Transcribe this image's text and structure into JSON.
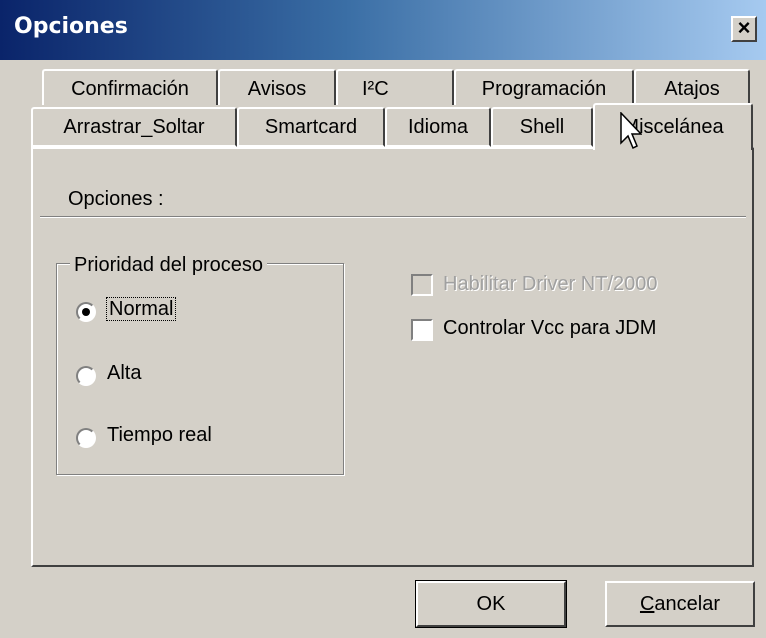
{
  "window": {
    "title": "Opciones",
    "close_glyph": "×"
  },
  "tabs": {
    "row1": [
      "Confirmación",
      "Avisos",
      "I²C",
      "Programación",
      "Atajos"
    ],
    "row2": [
      "Arrastrar_Soltar",
      "Smartcard",
      "Idioma",
      "Shell",
      "Miscelánea"
    ],
    "selected": "Miscelánea"
  },
  "panel": {
    "section_label": "Opciones :",
    "priority_group": {
      "title": "Prioridad del proceso",
      "options": [
        "Normal",
        "Alta",
        "Tiempo real"
      ],
      "selected": "Normal"
    },
    "checkboxes": [
      {
        "label": "Habilitar Driver NT/2000",
        "enabled": false,
        "checked": false
      },
      {
        "label": "Controlar Vcc para JDM",
        "enabled": true,
        "checked": false
      }
    ]
  },
  "buttons": {
    "ok": "OK",
    "cancel_first": "C",
    "cancel_rest": "ancelar"
  },
  "icons": {
    "close": "close-icon",
    "cursor": "mouse-pointer-icon"
  },
  "colors": {
    "face": "#d4d0c8",
    "title_start": "#0a246a",
    "title_end": "#a6caf0"
  }
}
